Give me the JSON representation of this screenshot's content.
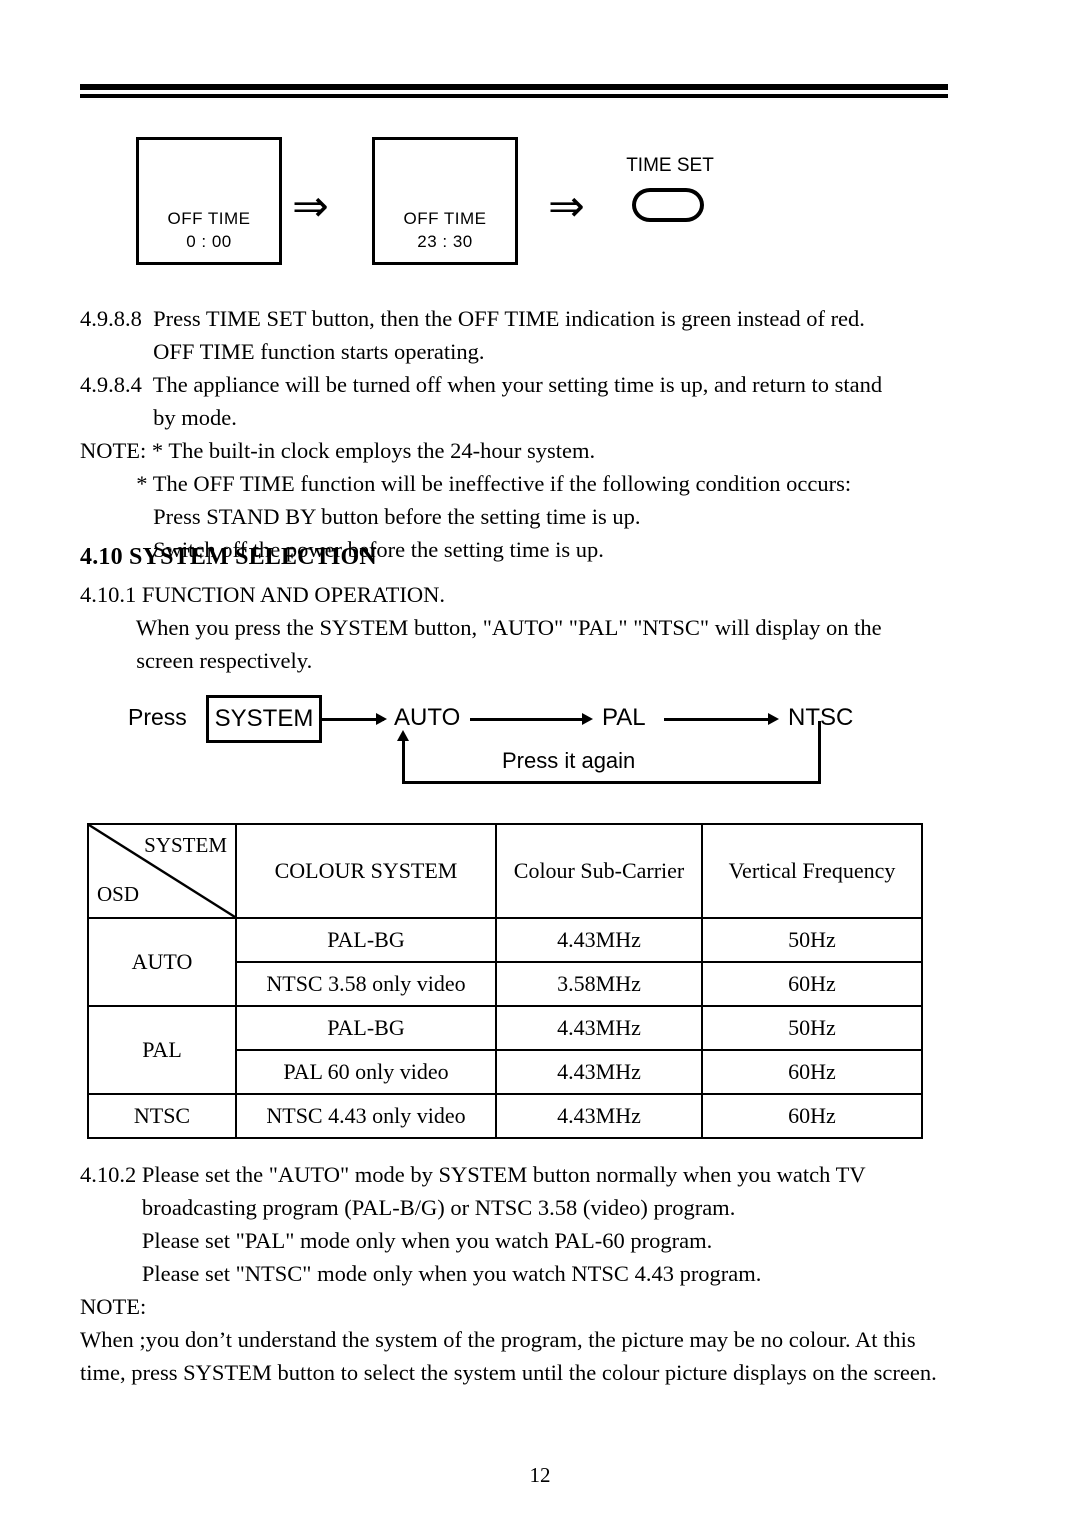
{
  "osd_diagram": {
    "screen1": {
      "line1": "OFF TIME",
      "line2": "0 : 00"
    },
    "screen2": {
      "line1": "OFF TIME",
      "line2": "23 : 30"
    },
    "arrow1": "⇒",
    "arrow2": "⇒",
    "time_set_label": "TIME SET"
  },
  "paragraphs": {
    "block1": "4.9.8.8  Press TIME SET button, then the OFF TIME indication is green instead of red.\n             OFF TIME function starts operating.\n4.9.8.4  The appliance will be turned off when your setting time is up, and return to stand\n             by mode.\nNOTE: * The built-in clock employs the 24-hour system.\n          * The OFF TIME function will be ineffective if the following condition occurs:\n             Press STAND BY button before the setting time is up.\n             Switch off the power before the setting time is up.",
    "heading_410": "4.10 SYSTEM SELECTION",
    "block2": "4.10.1 FUNCTION AND OPERATION.\n          When you press the SYSTEM button, \"AUTO\" \"PAL\" \"NTSC\" will display on the\n          screen respectively.",
    "block3": "4.10.2 Please set the \"AUTO\" mode by SYSTEM button normally when you watch TV\n           broadcasting program (PAL-B/G) or NTSC 3.58 (video) program.\n           Please set \"PAL\" mode only when you watch PAL-60 program.\n           Please set \"NTSC\" mode only when you watch NTSC 4.43 program.\nNOTE:\nWhen ;you don’t understand the system of the program, the picture may be no colour. At this\ntime, press SYSTEM button to select the system until the colour picture displays on the screen."
  },
  "flow_diagram": {
    "press_label": "Press",
    "system_button": "SYSTEM",
    "node_auto": "AUTO",
    "node_pal": "PAL",
    "node_ntsc": "NTSC",
    "loop_label": "Press it again"
  },
  "table": {
    "corner": {
      "top_right": "SYSTEM",
      "bottom_left": "OSD"
    },
    "headers": [
      "COLOUR SYSTEM",
      "Colour Sub-Carrier",
      "Vertical Frequency"
    ],
    "rows": [
      {
        "osd": "AUTO",
        "entries": [
          {
            "colour_system": "PAL-BG",
            "sub_carrier": "4.43MHz",
            "vertical_frequency": "50Hz"
          },
          {
            "colour_system": "NTSC 3.58 only video",
            "sub_carrier": "3.58MHz",
            "vertical_frequency": "60Hz"
          }
        ]
      },
      {
        "osd": "PAL",
        "entries": [
          {
            "colour_system": "PAL-BG",
            "sub_carrier": "4.43MHz",
            "vertical_frequency": "50Hz"
          },
          {
            "colour_system": "PAL 60 only video",
            "sub_carrier": "4.43MHz",
            "vertical_frequency": "60Hz"
          }
        ]
      },
      {
        "osd": "NTSC",
        "entries": [
          {
            "colour_system": "NTSC 4.43 only video",
            "sub_carrier": "4.43MHz",
            "vertical_frequency": "60Hz"
          }
        ]
      }
    ]
  },
  "footer": {
    "page_number": "12"
  }
}
